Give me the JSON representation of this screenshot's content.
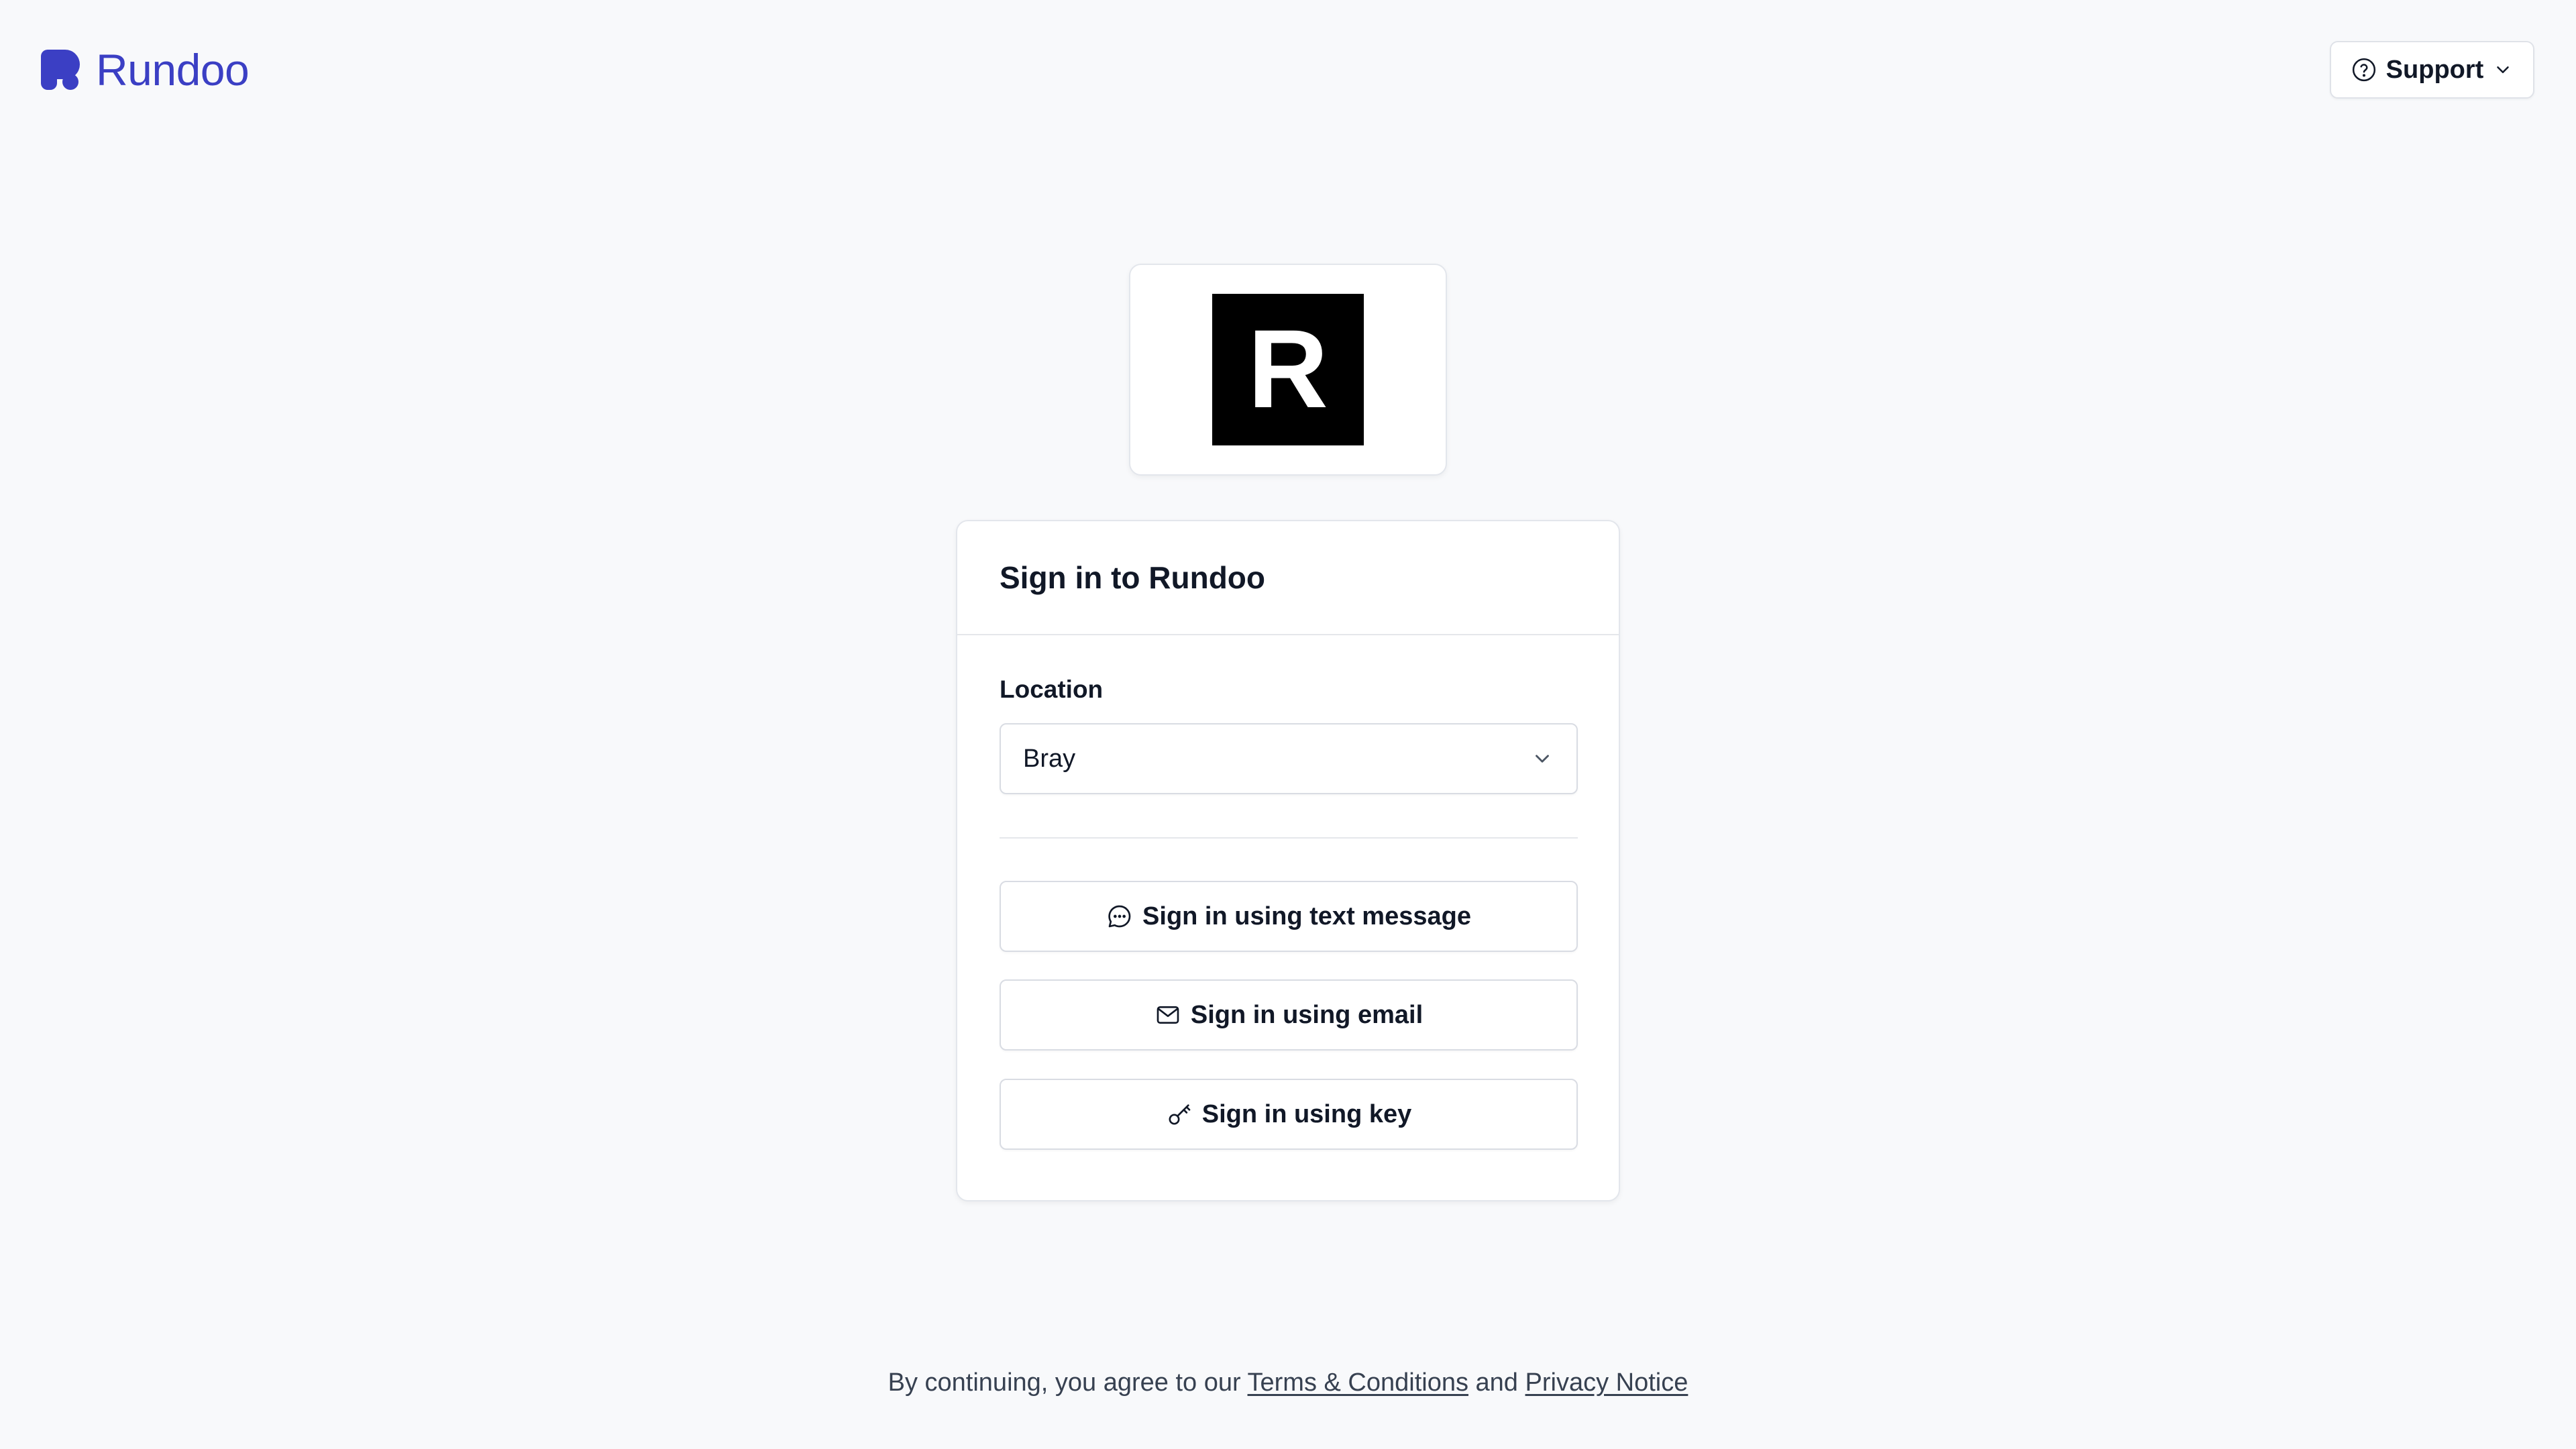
{
  "header": {
    "brand_name": "Rundoo",
    "support_label": "Support"
  },
  "logo": {
    "letter": "R"
  },
  "signin": {
    "title": "Sign in to Rundoo",
    "location_label": "Location",
    "location_value": "Bray",
    "buttons": {
      "text_message": "Sign in using text message",
      "email": "Sign in using email",
      "key": "Sign in using key"
    }
  },
  "footer": {
    "prefix": "By continuing, you agree to our ",
    "terms": "Terms & Conditions",
    "joiner": " and ",
    "privacy": "Privacy Notice"
  },
  "colors": {
    "brand": "#3b3fc4",
    "background": "#f8f9fb"
  }
}
